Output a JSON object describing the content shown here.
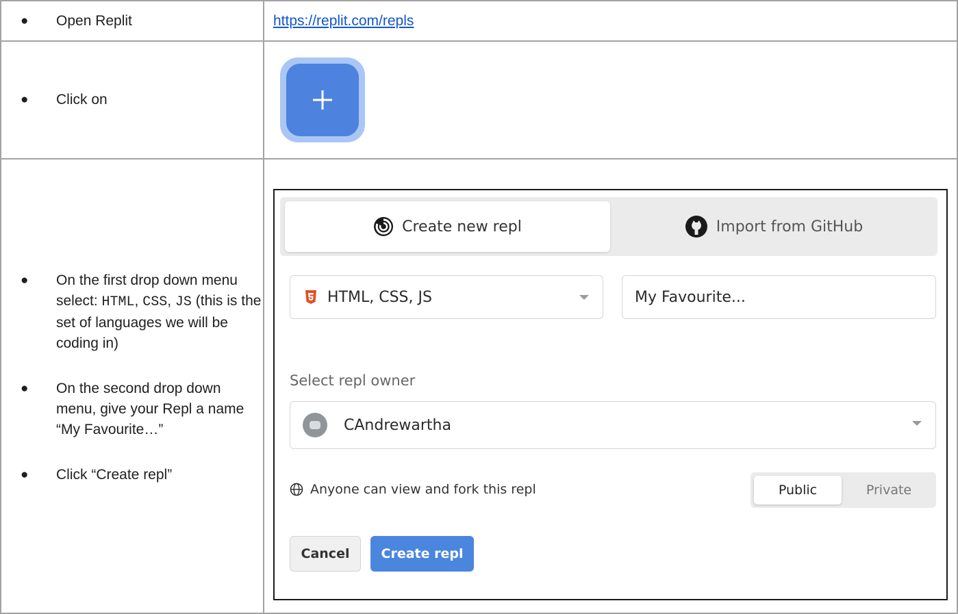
{
  "rows": [
    {
      "left_text": "Open Replit",
      "link": "https://replit.com/repls"
    },
    {
      "left_text": "Click on"
    },
    {
      "bullets": [
        {
          "pre": "On the first drop down menu select: ",
          "code1": "HTML",
          "mid1": ", ",
          "code2": "CSS",
          "mid2": ",  ",
          "code3": "JS",
          "post": " (this is the set of languages we will be coding in)"
        },
        {
          "text": "On the second drop down menu, give your Repl a name “My Favourite…”"
        },
        {
          "text": "Click “Create repl”"
        }
      ]
    }
  ],
  "bullet_glyph": "●",
  "dialog": {
    "tab_create": "Create new repl",
    "tab_import": "Import from GitHub",
    "language_value": "HTML, CSS, JS",
    "name_value": "My Favourite...",
    "owner_label": "Select repl owner",
    "owner_value": "CAndrewartha",
    "visibility_text": "Anyone can view and fork this repl",
    "public_label": "Public",
    "private_label": "Private",
    "cancel_label": "Cancel",
    "create_label": "Create repl"
  },
  "colors": {
    "link": "#1155cc",
    "accent": "#4a86de",
    "html5": "#e34f26"
  }
}
